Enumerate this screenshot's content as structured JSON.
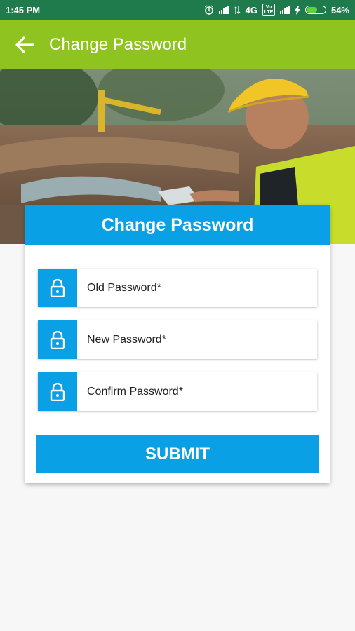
{
  "status_bar": {
    "time": "1:45 PM",
    "network": "4G",
    "volte": "Vo LTE",
    "battery": "54%",
    "battery_level": 0.54,
    "icons": [
      "alarm-icon",
      "signal-icon",
      "data-arrows-icon",
      "volte-icon",
      "signal-icon",
      "charging-icon",
      "battery-icon"
    ]
  },
  "app_bar": {
    "title": "Change Password",
    "back_icon": "arrow-left-icon"
  },
  "form": {
    "header": "Change Password",
    "fields": [
      {
        "placeholder": "Old Password*",
        "icon": "lock-icon"
      },
      {
        "placeholder": "New Password*",
        "icon": "lock-icon"
      },
      {
        "placeholder": "Confirm Password*",
        "icon": "lock-icon"
      }
    ],
    "submit_label": "SUBMIT"
  },
  "colors": {
    "status_bar": "#1f7a4c",
    "app_bar": "#8fc31f",
    "accent": "#0aa0e6",
    "background": "#f7f7f7"
  }
}
